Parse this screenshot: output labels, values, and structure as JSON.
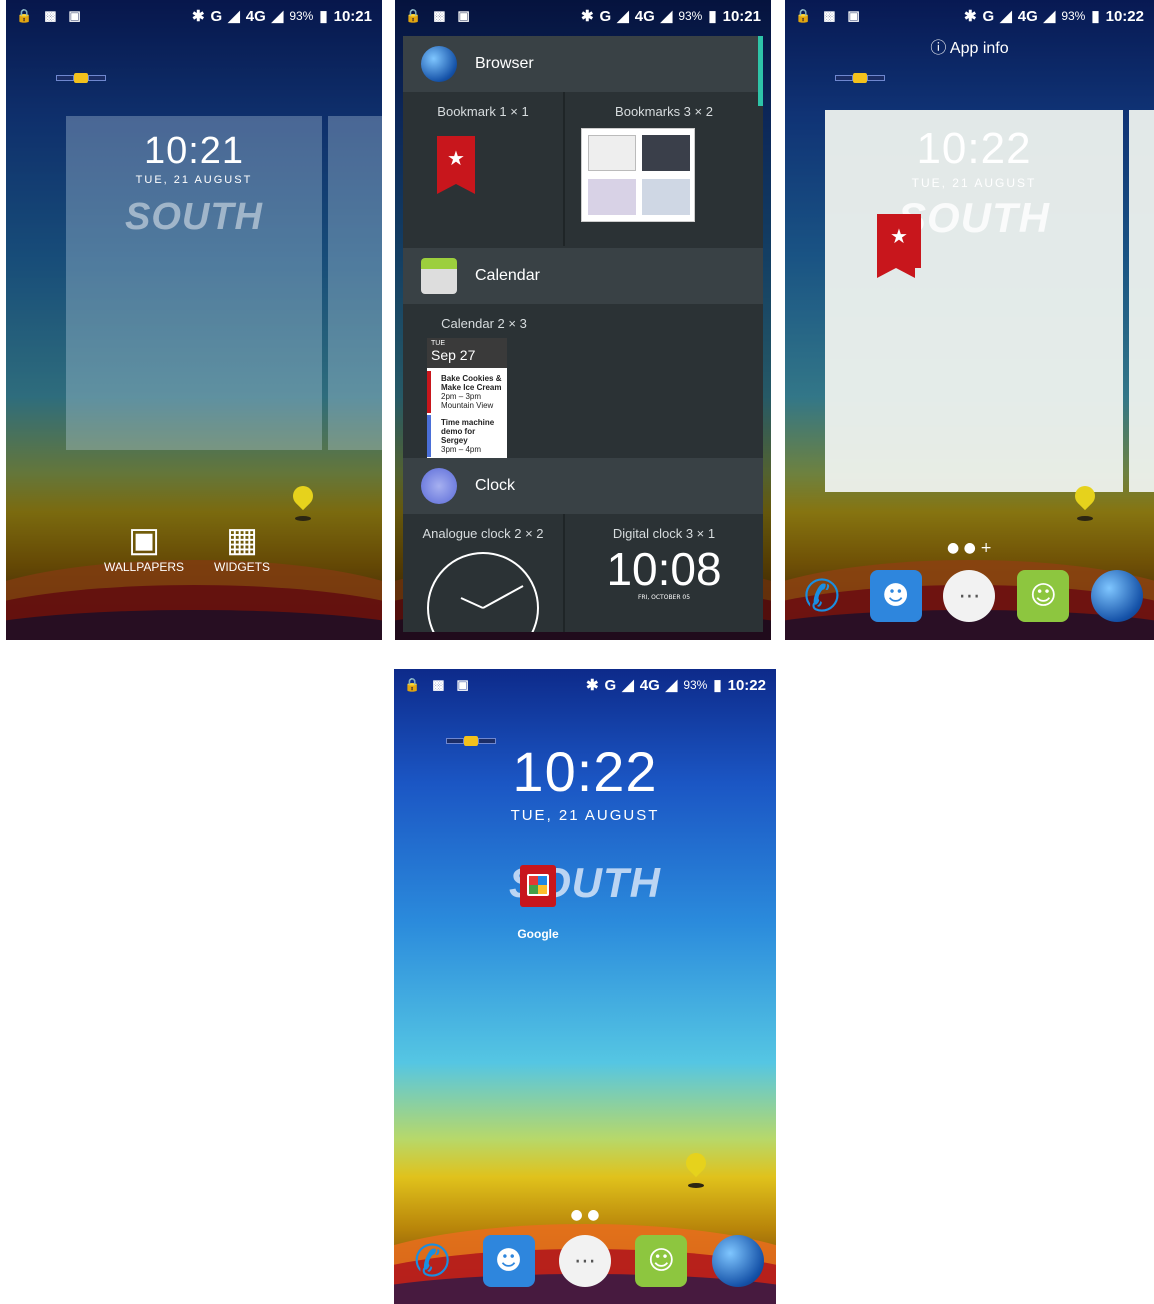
{
  "status": {
    "network": "G",
    "network_4g": "4G",
    "battery": "93%",
    "time_1": "10:21",
    "time_2": "10:21",
    "time_3": "10:22",
    "time_4": "10:22"
  },
  "home": {
    "clock_1021": "10:21",
    "clock_1022": "10:22",
    "date": "TUE, 21 AUGUST",
    "brand": "SOUTH",
    "page_dots_3": "● ● +",
    "page_dots_4": "● ●"
  },
  "overview": {
    "wallpapers_label": "WALLPAPERS",
    "widgets_label": "WIDGETS"
  },
  "widgets": {
    "browser": {
      "app": "Browser",
      "w1": "Bookmark  1 × 1",
      "w2": "Bookmarks  3 × 2"
    },
    "calendar": {
      "app": "Calendar",
      "w1": "Calendar  2 × 3",
      "dow": "TUE",
      "date": "Sep 27",
      "event1_title": "Bake Cookies & Make Ice Cream",
      "event1_time": "2pm – 3pm",
      "event1_place": "Mountain View",
      "event2_title": "Time machine demo for Sergey",
      "event2_time": "3pm – 4pm"
    },
    "clock": {
      "app": "Clock",
      "w1": "Analogue clock  2 × 2",
      "w2": "Digital clock  3 × 1",
      "digital_time": "10:08",
      "digital_date": "FRI, OCTOBER 05"
    }
  },
  "app_info": {
    "label": "App info"
  },
  "shortcut": {
    "label": "Google"
  },
  "colors": {
    "panel": "#2b3235",
    "header": "#394145",
    "bookmark_red": "#c8161c"
  },
  "icons": [
    "lock-icon",
    "sim-icon",
    "alert-icon",
    "bluetooth-icon",
    "signal-icon",
    "battery-icon",
    "phone-icon",
    "contacts-icon",
    "apps-icon",
    "messaging-icon",
    "browser-icon",
    "info-icon",
    "wallpapers-icon",
    "widgets-icon"
  ]
}
